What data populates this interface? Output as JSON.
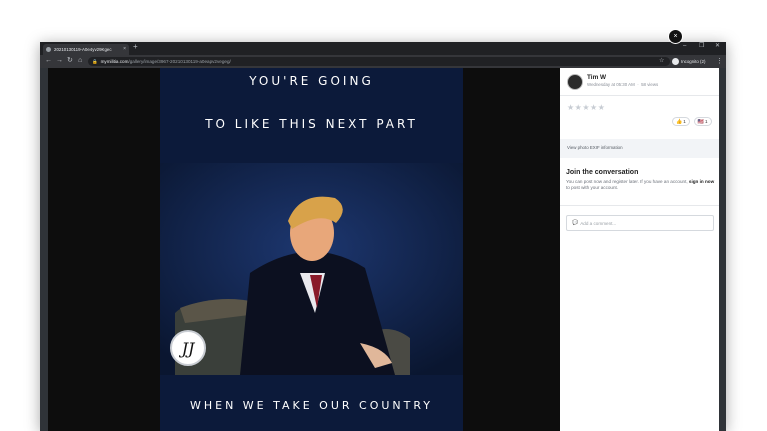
{
  "browser": {
    "tab_title": "20210130119-A0e4yv29Kgec",
    "tab_close": "×",
    "new_tab": "+",
    "window_controls": [
      "–",
      "❐",
      "✕"
    ],
    "url_host": "mymilitia.com",
    "url_path": "/gallery/image/3967-20210130119-a0eapv2vegeg/",
    "incognito_label": "Incognito (2)"
  },
  "meme": {
    "line1": "YOU'RE GOING",
    "line2": "TO LIKE THIS NEXT PART",
    "line3": "WHEN WE TAKE OUR COUNTRY",
    "watermark": "JJ"
  },
  "panel": {
    "close": "×",
    "author": "Tim W",
    "timestamp": "Wednesday at 05:30 AM",
    "views": "58 views",
    "rating_stars": "★★★★★",
    "reactions": [
      {
        "emoji": "👍",
        "count": "1"
      },
      {
        "emoji": "🇺🇸",
        "count": "1"
      }
    ],
    "exif_link": "View photo EXIF information",
    "join_title": "Join the conversation",
    "join_text_before": "You can post now and register later. If you have an account, ",
    "join_signin": "sign in now",
    "join_text_after": " to post with your account.",
    "comment_placeholder": "Add a comment..."
  },
  "colors": {
    "photo_bg": "#0c1a3a",
    "panel_bg": "#ffffff",
    "browser_frame": "#202124"
  }
}
